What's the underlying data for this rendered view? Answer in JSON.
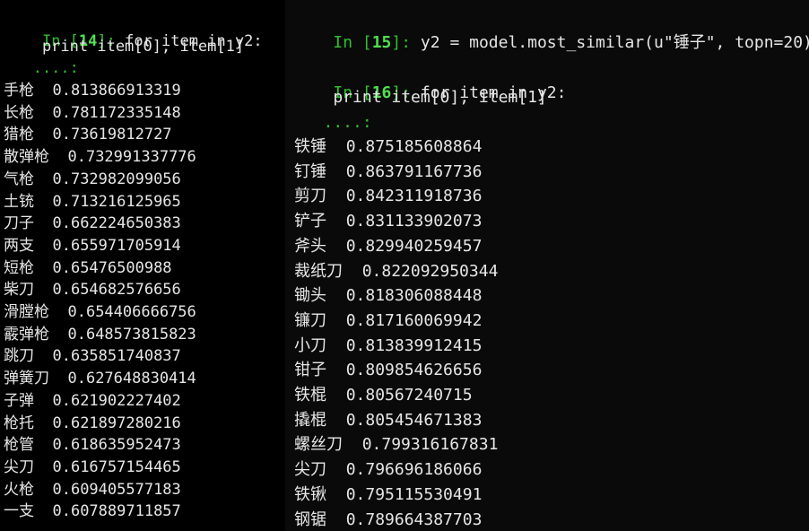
{
  "left": {
    "in_label": "In [",
    "cell_num": "14",
    "in_close": "]:",
    "code_line1": " for item in y2:",
    "code_line2": "    print item[0], item[1]",
    "continuation": "   ....:",
    "results": [
      {
        "word": "手枪",
        "score": "0.813866913319"
      },
      {
        "word": "长枪",
        "score": "0.781172335148"
      },
      {
        "word": "猎枪",
        "score": "0.73619812727"
      },
      {
        "word": "散弹枪",
        "score": "0.732991337776"
      },
      {
        "word": "气枪",
        "score": "0.732982099056"
      },
      {
        "word": "土铳",
        "score": "0.713216125965"
      },
      {
        "word": "刀子",
        "score": "0.662224650383"
      },
      {
        "word": "两支",
        "score": "0.655971705914"
      },
      {
        "word": "短枪",
        "score": "0.65476500988"
      },
      {
        "word": "柴刀",
        "score": "0.654682576656"
      },
      {
        "word": "滑膛枪",
        "score": "0.654406666756"
      },
      {
        "word": "霰弹枪",
        "score": "0.648573815823"
      },
      {
        "word": "跳刀",
        "score": "0.635851740837"
      },
      {
        "word": "弹簧刀",
        "score": "0.627648830414"
      },
      {
        "word": "子弹",
        "score": "0.621902227402"
      },
      {
        "word": "枪托",
        "score": "0.621897280216"
      },
      {
        "word": "枪管",
        "score": "0.618635952473"
      },
      {
        "word": "尖刀",
        "score": "0.616757154465"
      },
      {
        "word": "火枪",
        "score": "0.609405577183"
      },
      {
        "word": "一支",
        "score": "0.607889711857"
      }
    ]
  },
  "right": {
    "cell15": {
      "in_label": "In [",
      "cell_num": "15",
      "in_close": "]:",
      "code": " y2 = model.most_similar(u\"锤子\", topn=20)"
    },
    "cell16": {
      "in_label": "In [",
      "cell_num": "16",
      "in_close": "]:",
      "code_line1": " for item in y2:",
      "code_line2": "    print item[0], item[1]",
      "continuation": "   ....:"
    },
    "results": [
      {
        "word": "铁锤",
        "score": "0.875185608864"
      },
      {
        "word": "钉锤",
        "score": "0.863791167736"
      },
      {
        "word": "剪刀",
        "score": "0.842311918736"
      },
      {
        "word": "铲子",
        "score": "0.831133902073"
      },
      {
        "word": "斧头",
        "score": "0.829940259457"
      },
      {
        "word": "裁纸刀",
        "score": "0.822092950344"
      },
      {
        "word": "锄头",
        "score": "0.818306088448"
      },
      {
        "word": "镰刀",
        "score": "0.817160069942"
      },
      {
        "word": "小刀",
        "score": "0.813839912415"
      },
      {
        "word": "钳子",
        "score": "0.809854626656"
      },
      {
        "word": "铁棍",
        "score": "0.80567240715"
      },
      {
        "word": "撬棍",
        "score": "0.805454671383"
      },
      {
        "word": "螺丝刀",
        "score": "0.799316167831"
      },
      {
        "word": "尖刀",
        "score": "0.796696186066"
      },
      {
        "word": "铁锹",
        "score": "0.795115530491"
      },
      {
        "word": "钢锯",
        "score": "0.789664387703"
      }
    ]
  }
}
